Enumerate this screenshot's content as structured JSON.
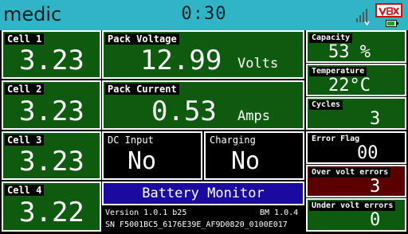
{
  "header": {
    "app_name": "medic",
    "timer": "0:30",
    "logo_text": "VEX"
  },
  "cells": [
    {
      "label": "Cell 1",
      "value": "3.23"
    },
    {
      "label": "Cell 2",
      "value": "3.23"
    },
    {
      "label": "Cell 3",
      "value": "3.23"
    },
    {
      "label": "Cell 4",
      "value": "3.22"
    }
  ],
  "pack_voltage": {
    "label": "Pack Voltage",
    "value": "12.99",
    "unit": "Volts"
  },
  "pack_current": {
    "label": "Pack Current",
    "value": "0.53",
    "unit": "Amps"
  },
  "dc_input": {
    "label": "DC Input",
    "value": "No"
  },
  "charging": {
    "label": "Charging",
    "value": "No"
  },
  "capacity": {
    "label": "Capacity",
    "value": "53 %"
  },
  "temperature": {
    "label": "Temperature",
    "value": "22°C"
  },
  "cycles": {
    "label": "Cycles",
    "value": "3"
  },
  "error_flag": {
    "label": "Error Flag",
    "value": "00"
  },
  "over_volt": {
    "label": "Over volt errors",
    "value": "3"
  },
  "under_volt": {
    "label": "Under volt errors",
    "value": "0"
  },
  "footer": {
    "title": "Battery Monitor",
    "version": "Version 1.0.1 b25",
    "bm_version": "BM 1.0.4",
    "serial": "SN F5001BC5_6176E39E_AF9D0820_0100E017"
  },
  "colors": {
    "topbar": "#2fb5c6",
    "panel_green": "#0e5b10",
    "monitor_blue": "#1a0aa0",
    "error_red": "#5a0000"
  }
}
